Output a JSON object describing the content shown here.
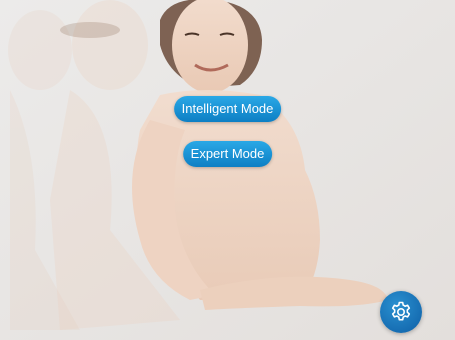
{
  "modes": {
    "intelligent_label": "Intelligent Mode",
    "expert_label": "Expert Mode"
  },
  "settings": {
    "icon": "gear-icon"
  },
  "colors": {
    "button_blue": "#1a96d8",
    "settings_blue": "#1672b8",
    "background": "#e9e7e6"
  }
}
